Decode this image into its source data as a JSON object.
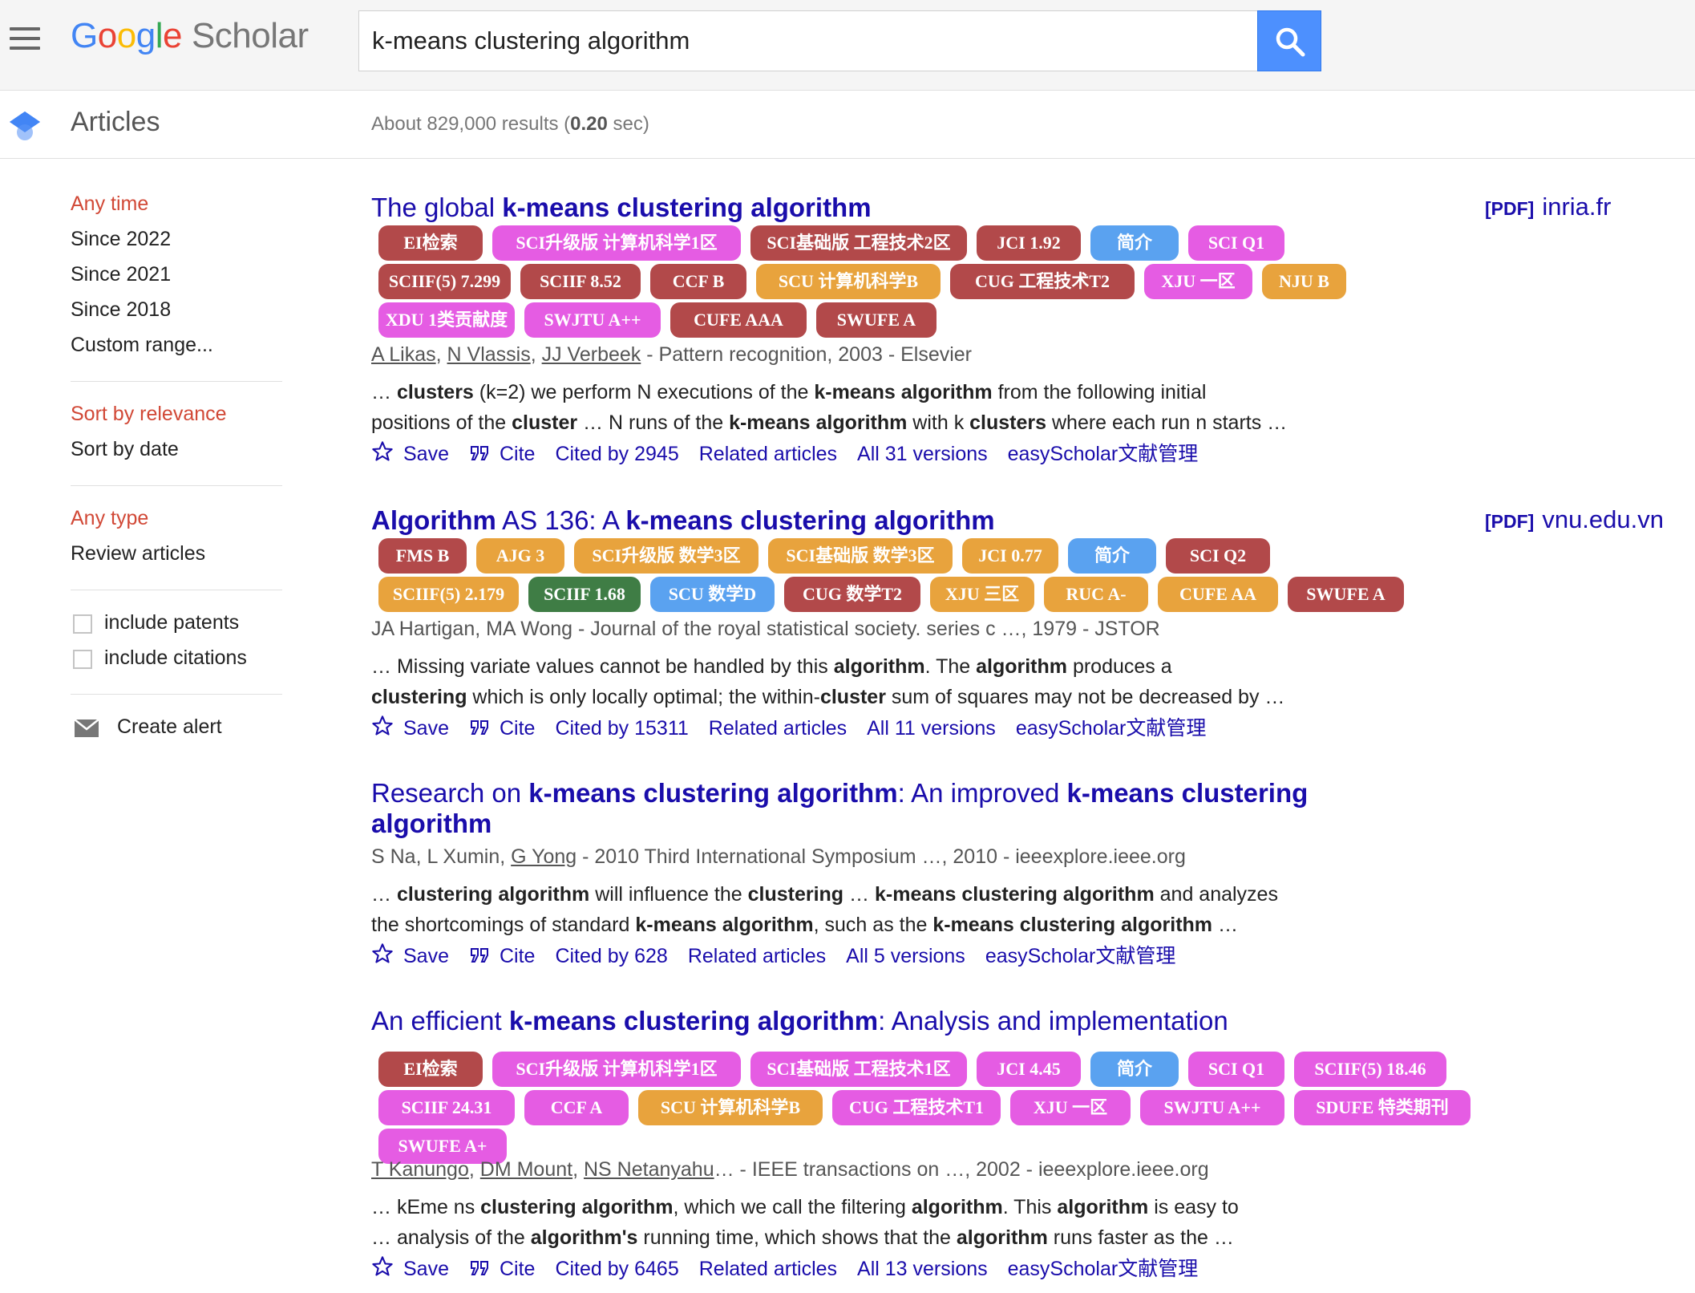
{
  "header": {
    "logo_google": [
      "G",
      "o",
      "o",
      "g",
      "l",
      "e"
    ],
    "logo_scholar": "Scholar",
    "search_value": "k-means clustering algorithm"
  },
  "subheader": {
    "section": "Articles",
    "results_prefix": "About 829,000 results (",
    "results_time": "0.20",
    "results_suffix": " sec)"
  },
  "sidebar": {
    "time": [
      "Any time",
      "Since 2022",
      "Since 2021",
      "Since 2018",
      "Custom range..."
    ],
    "sort": [
      "Sort by relevance",
      "Sort by date"
    ],
    "type": [
      "Any type",
      "Review articles"
    ],
    "checkboxes": [
      "include patents",
      "include citations"
    ],
    "alert": "Create alert"
  },
  "actions": {
    "save": "Save",
    "cite": "Cite",
    "related": "Related articles",
    "easyscholar": "easyScholar文献管理"
  },
  "results": [
    {
      "title_parts": [
        [
          "The global ",
          false
        ],
        [
          "k-means clustering algorithm",
          true
        ]
      ],
      "pdf_tag": "[PDF]",
      "pdf_domain": "inria.fr",
      "badges": [
        [
          "EI检索",
          "brown"
        ],
        [
          "SCI升级版 计算机科学1区",
          "magenta"
        ],
        [
          "SCI基础版 工程技术2区",
          "brown"
        ],
        [
          "JCI 1.92",
          "brown"
        ],
        [
          "简介",
          "blue"
        ],
        [
          "SCI Q1",
          "magenta"
        ],
        [
          "SCIIF(5) 7.299",
          "brown"
        ],
        [
          "SCIIF 8.52",
          "brown"
        ],
        [
          "CCF B",
          "brown"
        ],
        [
          "SCU 计算机科学B",
          "orange"
        ],
        [
          "CUG 工程技术T2",
          "brown"
        ],
        [
          "XJU 一区",
          "magenta"
        ],
        [
          "NJU B",
          "orange"
        ],
        [
          "XDU 1类贡献度",
          "magenta"
        ],
        [
          "SWJTU A++",
          "magenta"
        ],
        [
          "CUFE AAA",
          "brown"
        ],
        [
          "SWUFE A",
          "brown"
        ]
      ],
      "authors": [
        [
          "A Likas",
          true
        ],
        [
          ", ",
          false
        ],
        [
          "N Vlassis",
          true
        ],
        [
          ", ",
          false
        ],
        [
          "JJ Verbeek",
          true
        ],
        [
          " - Pattern recognition, 2003 - Elsevier",
          false
        ]
      ],
      "snippet": [
        [
          [
            "… ",
            false
          ],
          [
            "clusters",
            true
          ],
          [
            " (k=2) we perform N executions of the ",
            false
          ],
          [
            "k-means algorithm",
            true
          ],
          [
            " from the following initial",
            false
          ]
        ],
        [
          [
            "positions of the ",
            false
          ],
          [
            "cluster",
            true
          ],
          [
            " … N runs of the ",
            false
          ],
          [
            "k-means algorithm",
            true
          ],
          [
            " with k ",
            false
          ],
          [
            "clusters",
            true
          ],
          [
            " where each run n starts …",
            false
          ]
        ]
      ],
      "cited_by": "Cited by 2945",
      "versions": "All 31 versions"
    },
    {
      "title_parts": [
        [
          "Algorithm",
          true
        ],
        [
          " AS 136: A ",
          false
        ],
        [
          "k-means clustering algorithm",
          true
        ]
      ],
      "pdf_tag": "[PDF]",
      "pdf_domain": "vnu.edu.vn",
      "badges": [
        [
          "FMS B",
          "brown"
        ],
        [
          "AJG 3",
          "orange"
        ],
        [
          "SCI升级版 数学3区",
          "orange"
        ],
        [
          "SCI基础版 数学3区",
          "orange"
        ],
        [
          "JCI 0.77",
          "orange"
        ],
        [
          "简介",
          "blue"
        ],
        [
          "SCI Q2",
          "brown"
        ],
        [
          "SCIIF(5) 2.179",
          "orange"
        ],
        [
          "SCIIF 1.68",
          "green"
        ],
        [
          "SCU 数学D",
          "blue"
        ],
        [
          "CUG 数学T2",
          "brown"
        ],
        [
          "XJU 三区",
          "orange"
        ],
        [
          "RUC A-",
          "orange"
        ],
        [
          "CUFE AA",
          "orange"
        ],
        [
          "SWUFE A",
          "brown"
        ]
      ],
      "authors": [
        [
          "JA Hartigan, MA Wong - Journal of the royal statistical society. series c …, 1979 - JSTOR",
          false
        ]
      ],
      "snippet": [
        [
          [
            "… Missing variate values cannot be handled by this ",
            false
          ],
          [
            "algorithm",
            true
          ],
          [
            ". The ",
            false
          ],
          [
            "algorithm",
            true
          ],
          [
            " produces a",
            false
          ]
        ],
        [
          [
            "clustering",
            true
          ],
          [
            " which is only locally optimal; the within-",
            false
          ],
          [
            "cluster",
            true
          ],
          [
            " sum of squares may not be decreased by …",
            false
          ]
        ]
      ],
      "cited_by": "Cited by 15311",
      "versions": "All 11 versions"
    },
    {
      "title_parts": [
        [
          "Research on ",
          false
        ],
        [
          "k-means clustering algorithm",
          true
        ],
        [
          ": An improved ",
          false
        ],
        [
          "k-means clustering",
          true
        ],
        [
          "\n",
          false
        ],
        [
          "algorithm",
          true
        ]
      ],
      "badges": [],
      "authors": [
        [
          "S Na, L Xumin, ",
          false
        ],
        [
          "G Yong",
          true
        ],
        [
          " - 2010 Third International Symposium …, 2010 - ieeexplore.ieee.org",
          false
        ]
      ],
      "snippet": [
        [
          [
            "… ",
            false
          ],
          [
            "clustering algorithm",
            true
          ],
          [
            " will influence the ",
            false
          ],
          [
            "clustering",
            true
          ],
          [
            " … ",
            false
          ],
          [
            "k-means clustering algorithm",
            true
          ],
          [
            " and analyzes",
            false
          ]
        ],
        [
          [
            "the shortcomings of standard ",
            false
          ],
          [
            "k-means algorithm",
            true
          ],
          [
            ", such as the ",
            false
          ],
          [
            "k-means clustering algorithm",
            true
          ],
          [
            " …",
            false
          ]
        ]
      ],
      "cited_by": "Cited by 628",
      "versions": "All 5 versions"
    },
    {
      "title_parts": [
        [
          "An efficient ",
          false
        ],
        [
          "k-means clustering algorithm",
          true
        ],
        [
          ": Analysis and implementation",
          false
        ]
      ],
      "badges": [
        [
          "EI检索",
          "brown"
        ],
        [
          "SCI升级版 计算机科学1区",
          "magenta"
        ],
        [
          "SCI基础版 工程技术1区",
          "magenta"
        ],
        [
          "JCI 4.45",
          "magenta"
        ],
        [
          "简介",
          "blue"
        ],
        [
          "SCI Q1",
          "magenta"
        ],
        [
          "SCIIF(5) 18.46",
          "magenta"
        ],
        [
          "SCIIF 24.31",
          "magenta"
        ],
        [
          "CCF A",
          "magenta"
        ],
        [
          "SCU 计算机科学B",
          "orange"
        ],
        [
          "CUG 工程技术T1",
          "magenta"
        ],
        [
          "XJU 一区",
          "magenta"
        ],
        [
          "SWJTU A++",
          "magenta"
        ],
        [
          "SDUFE 特类期刊",
          "magenta"
        ],
        [
          "SWUFE A+",
          "magenta"
        ]
      ],
      "authors": [
        [
          "T Kanungo",
          true
        ],
        [
          ", ",
          false
        ],
        [
          "DM Mount",
          true
        ],
        [
          ", ",
          false
        ],
        [
          "NS Netanyahu",
          true
        ],
        [
          "… - IEEE transactions on …, 2002 - ieeexplore.ieee.org",
          false
        ]
      ],
      "snippet": [
        [
          [
            "… kEme ns ",
            false
          ],
          [
            "clustering algorithm",
            true
          ],
          [
            ", which we call the filtering ",
            false
          ],
          [
            "algorithm",
            true
          ],
          [
            ". This ",
            false
          ],
          [
            "algorithm",
            true
          ],
          [
            " is easy to",
            false
          ]
        ],
        [
          [
            "… analysis of the ",
            false
          ],
          [
            "algorithm's",
            true
          ],
          [
            " running time, which shows that the ",
            false
          ],
          [
            "algorithm",
            true
          ],
          [
            " runs faster as the …",
            false
          ]
        ]
      ],
      "cited_by": "Cited by 6465",
      "versions": "All 13 versions"
    }
  ]
}
